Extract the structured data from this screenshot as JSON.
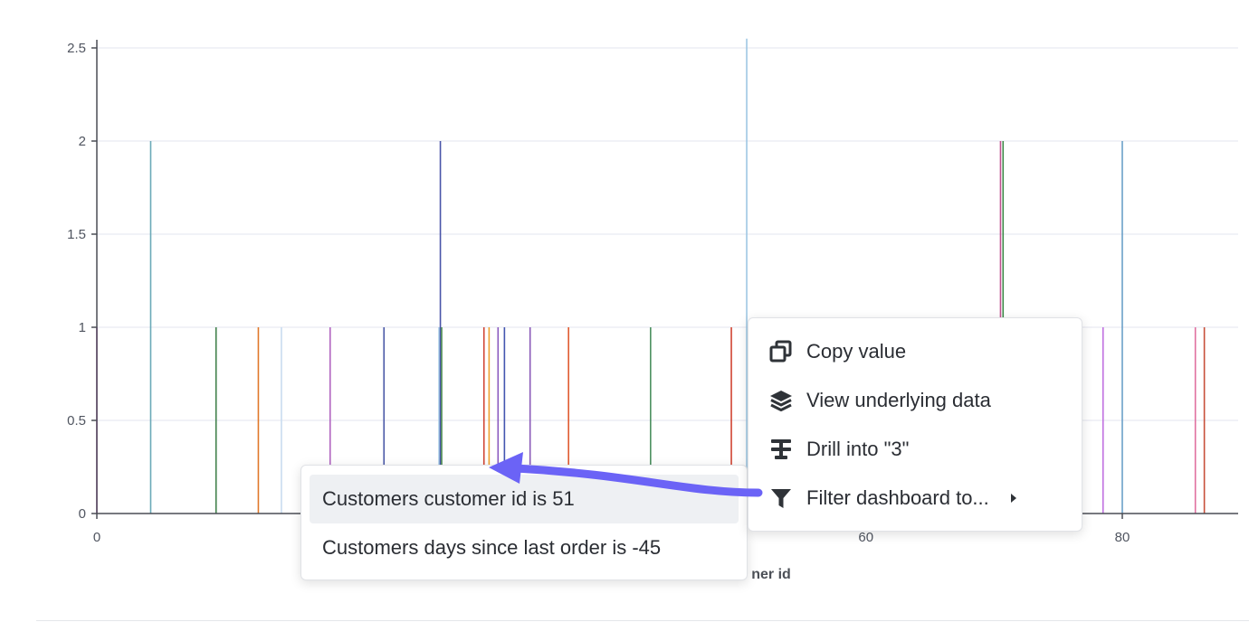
{
  "chart_data": {
    "type": "bar",
    "xlabel_visible_fragment": "ner id",
    "x_ticks": [
      "0",
      "60",
      "80"
    ],
    "y_ticks": [
      "0",
      "0.5",
      "1",
      "1.5",
      "2",
      "2.5"
    ],
    "xlim": [
      0,
      89
    ],
    "ylim": [
      0,
      2.55
    ],
    "grid": true,
    "points": [
      {
        "x": 0,
        "y": 1,
        "color": "#c155c4"
      },
      {
        "x": 4.2,
        "y": 2,
        "color": "#6aa9b8"
      },
      {
        "x": 9.3,
        "y": 1,
        "color": "#3f7f4a"
      },
      {
        "x": 12.6,
        "y": 1,
        "color": "#e0782a"
      },
      {
        "x": 14.4,
        "y": 1,
        "color": "#c9dcf0"
      },
      {
        "x": 18.2,
        "y": 1,
        "color": "#b064c0"
      },
      {
        "x": 22.4,
        "y": 1,
        "color": "#4c5aa8"
      },
      {
        "x": 26.7,
        "y": 1,
        "color": "#9ec7e3"
      },
      {
        "x": 26.8,
        "y": 2,
        "color": "#4854a8"
      },
      {
        "x": 26.9,
        "y": 1,
        "color": "#4c8a50"
      },
      {
        "x": 30.2,
        "y": 1,
        "color": "#d04433"
      },
      {
        "x": 30.6,
        "y": 1,
        "color": "#f0a030"
      },
      {
        "x": 31.3,
        "y": 1,
        "color": "#8c5cc0"
      },
      {
        "x": 31.8,
        "y": 1,
        "color": "#4456b0"
      },
      {
        "x": 33.8,
        "y": 1,
        "color": "#8a5ab8"
      },
      {
        "x": 36.8,
        "y": 1,
        "color": "#e05a30"
      },
      {
        "x": 43.2,
        "y": 1,
        "color": "#4c9060"
      },
      {
        "x": 49.5,
        "y": 1,
        "color": "#d04433"
      },
      {
        "x": 50.7,
        "y": 2.55,
        "color": "#9ec7e3"
      },
      {
        "x": 70.5,
        "y": 2,
        "color": "#c05090"
      },
      {
        "x": 70.7,
        "y": 2,
        "color": "#3f8a4a"
      },
      {
        "x": 78.5,
        "y": 1,
        "color": "#c070e0"
      },
      {
        "x": 80,
        "y": 2,
        "color": "#6aa0c8"
      },
      {
        "x": 85.7,
        "y": 1,
        "color": "#e070a0"
      },
      {
        "x": 86.4,
        "y": 1,
        "color": "#c8503a"
      }
    ]
  },
  "action_menu": {
    "items": [
      {
        "label": "Copy value",
        "icon": "copy-icon"
      },
      {
        "label": "View underlying data",
        "icon": "layers-icon"
      },
      {
        "label": "Drill into \"3\"",
        "icon": "drill-icon"
      },
      {
        "label": "Filter dashboard to...",
        "icon": "filter-icon",
        "has_submenu": true
      }
    ]
  },
  "filter_submenu": {
    "items": [
      {
        "label": "Customers customer id is 51",
        "active": true
      },
      {
        "label": "Customers days since last order is -45",
        "active": false
      }
    ]
  },
  "colors": {
    "hint_arrow": "#6b63f6",
    "gridline": "#e3e4ef",
    "axis": "#4a4d55"
  }
}
